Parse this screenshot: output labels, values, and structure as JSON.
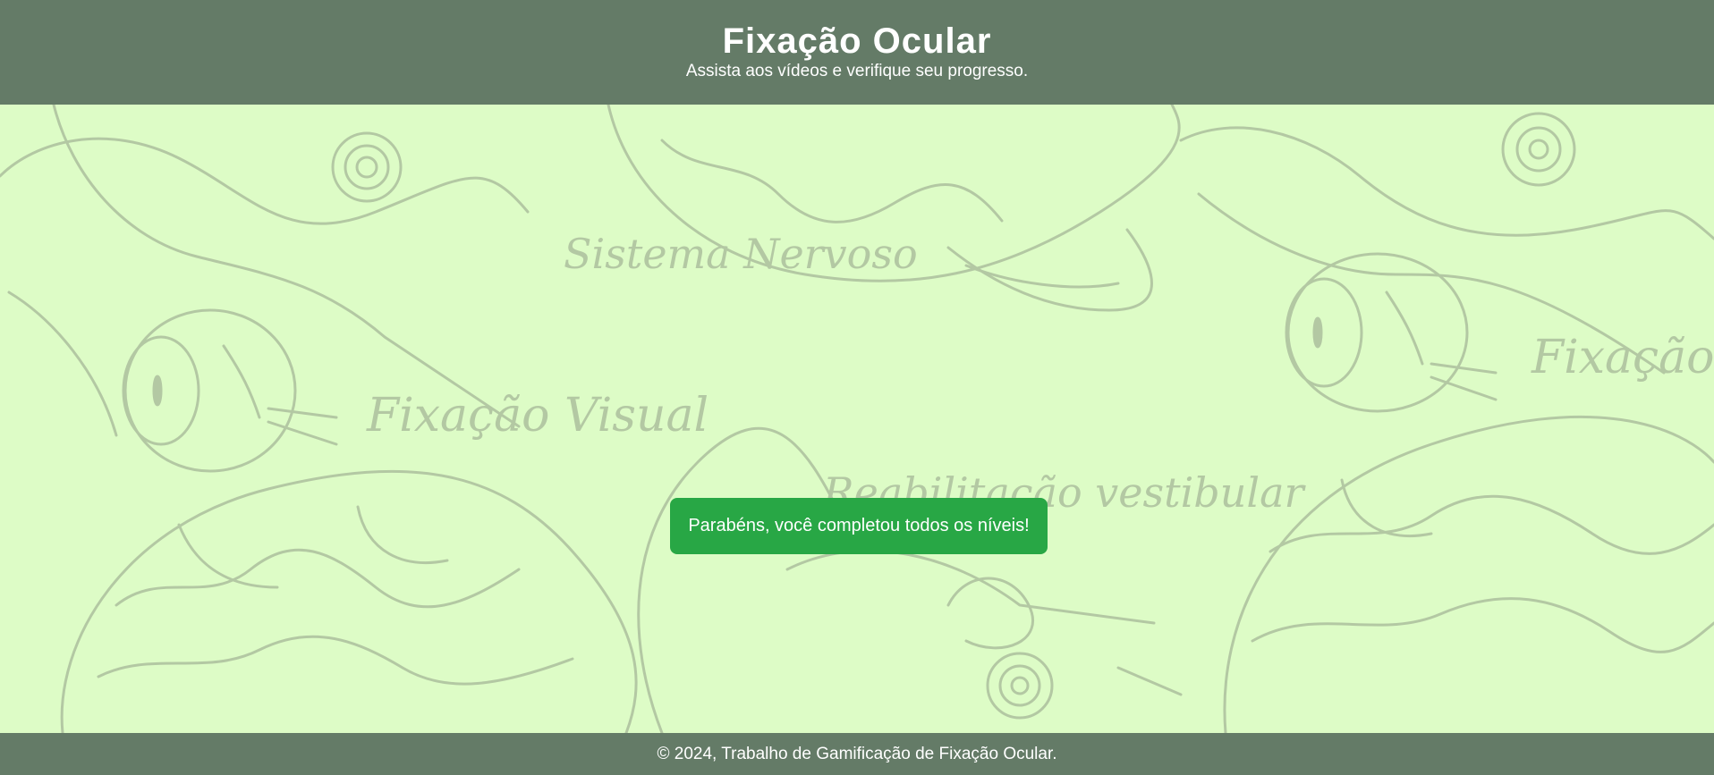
{
  "header": {
    "title": "Fixação Ocular",
    "subtitle": "Assista aos vídeos e verifique seu progresso."
  },
  "background": {
    "labels": [
      "Sistema Nervoso",
      "Fixação Visual",
      "Reabilitação vestibular",
      "Fixação"
    ],
    "icons": [
      "brain-illustration",
      "ear-illustration",
      "eye-illustration"
    ]
  },
  "main": {
    "message": "Parabéns, você completou todos os níveis!"
  },
  "footer": {
    "text": "© 2024, Trabalho de Gamificação de Fixação Ocular."
  },
  "colors": {
    "header_bg": "#647b67",
    "page_bg": "#ddfcc6",
    "message_bg": "#28a745",
    "illustration": "#b3c8a3"
  }
}
